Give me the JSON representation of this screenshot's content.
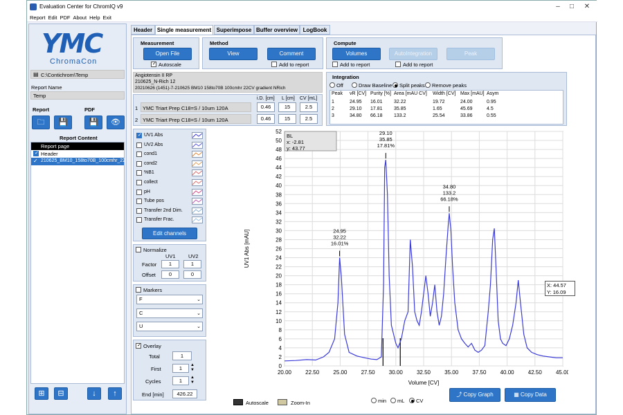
{
  "window": {
    "title": "Evaluation Center for ChromIQ v9"
  },
  "menu": [
    "Report",
    "Edit",
    "PDF",
    "About",
    "Help",
    "Exit"
  ],
  "left": {
    "logo_big": "YMC",
    "logo_small": "ChromaCon",
    "path": "C:\\Contichrom\\Temp",
    "report_name_label": "Report Name",
    "report_name": "Temp",
    "report_label": "Report",
    "pdf_label": "PDF",
    "report_content_label": "Report Content",
    "report_rows": [
      "Report page",
      "Header",
      "210625_BM10_158to70B_100cmhr_22"
    ]
  },
  "tabs": [
    "Header",
    "Single measurement",
    "Superimpose",
    "Buffer overview",
    "LogBook"
  ],
  "measurement": {
    "title": "Measurement",
    "open_file": "Open File",
    "autoscale": "Autoscale"
  },
  "method": {
    "title": "Method",
    "view": "View",
    "comment": "Comment",
    "add_to_report": "Add to report"
  },
  "compute": {
    "title": "Compute",
    "volumes": "Volumes",
    "autointegration": "AutoIntegration",
    "peak": "Peak",
    "add_to_report_1": "Add to report",
    "add_to_report_2": "Add to report"
  },
  "info": {
    "lines": [
      "Angiotensin II RP",
      "210625_N-Rich 12",
      "20210626 (1451)-7-210625 BM10 158to70B 100cmhr 22CV gradient NRich"
    ],
    "col_headers": [
      "i.D. [cm]",
      "L [cm]",
      "CV [mL]"
    ],
    "columns": [
      {
        "idx": "1",
        "name": "YMC Triart Prep C18=S / 10um 120A",
        "id": "0.46",
        "l": "15",
        "cv": "2.5"
      },
      {
        "idx": "2",
        "name": "YMC Triart Prep C18=S / 10um 120A",
        "id": "0.46",
        "l": "15",
        "cv": "2.5"
      }
    ]
  },
  "integration": {
    "title": "Integration",
    "options": [
      "Off",
      "Draw Baseline",
      "Split peaks",
      "Remove peaks"
    ],
    "selected": "Split peaks",
    "headers": [
      "Peak",
      "vR [CV]",
      "Purity [%]",
      "Area [mAU CV]",
      "Width [CV]",
      "Max [mAU]",
      "Asym"
    ],
    "rows": [
      [
        "1",
        "24.95",
        "16.01",
        "32.22",
        "19.72",
        "24.00",
        "0.95"
      ],
      [
        "2",
        "29.10",
        "17.81",
        "35.85",
        "1.65",
        "45.69",
        "4.5"
      ],
      [
        "3",
        "34.80",
        "66.18",
        "133.2",
        "25.54",
        "33.86",
        "0.55"
      ]
    ]
  },
  "channels": {
    "items": [
      {
        "label": "UV1 Abs",
        "checked": true,
        "color": "#3b3bd6"
      },
      {
        "label": "UV2 Abs",
        "checked": false,
        "color": "#5a5ae0"
      },
      {
        "label": "cond1",
        "checked": false,
        "color": "#e08a3c"
      },
      {
        "label": "cond2",
        "checked": false,
        "color": "#e0a05a"
      },
      {
        "label": "%B1",
        "checked": false,
        "color": "#d96b6b"
      },
      {
        "label": "collect",
        "checked": false,
        "color": "#e07070"
      },
      {
        "label": "pH",
        "checked": false,
        "color": "#d64a8a"
      },
      {
        "label": "Tube pos",
        "checked": false,
        "color": "#c05ab0"
      },
      {
        "label": "Transfer 2nd Dim.",
        "checked": false,
        "color": "#8ab0d0"
      },
      {
        "label": "Transfer Frac.",
        "checked": false,
        "color": "#9cc0e0"
      }
    ],
    "edit_button": "Edit channels"
  },
  "normalize": {
    "title": "Normalize",
    "uv1": "UV1",
    "uv2": "UV2",
    "factor_label": "Factor",
    "offset_label": "Offset",
    "factor_uv1": "1",
    "factor_uv2": "1",
    "offset_uv1": "0",
    "offset_uv2": "0"
  },
  "markers": {
    "title": "Markers",
    "selects": [
      "F",
      "C",
      "U"
    ]
  },
  "overlay": {
    "title": "Overlay",
    "total_label": "Total",
    "total": "1",
    "first_label": "First",
    "first": "1",
    "cycles_label": "Cycles",
    "cycles": "1",
    "end_label": "End [min]",
    "end": "426.22"
  },
  "chart_footer": {
    "autoscale": "Autoscale",
    "zoom_in": "Zoom-In",
    "units": [
      "min",
      "mL",
      "CV"
    ],
    "unit_selected": "CV",
    "copy_graph": "Copy Graph",
    "copy_data": "Copy Data"
  },
  "cursor_box": {
    "x": "X: 44.57",
    "y": "Y: 16.09"
  },
  "chart_data": {
    "type": "line",
    "xlabel": "Volume [CV]",
    "ylabel": "UV1 Abs [mAU]",
    "xlim": [
      20.0,
      45.0
    ],
    "ylim": [
      0,
      52
    ],
    "xticks": [
      "20.00",
      "22.50",
      "25.00",
      "27.50",
      "30.00",
      "32.50",
      "35.00",
      "37.50",
      "40.00",
      "42.50",
      "45.00"
    ],
    "yticks": [
      0,
      2,
      4,
      6,
      8,
      10,
      12,
      14,
      16,
      18,
      20,
      22,
      24,
      26,
      28,
      30,
      32,
      34,
      36,
      38,
      40,
      42,
      44,
      46,
      48,
      50,
      52
    ],
    "grid": true,
    "legend_box": {
      "label": "BL",
      "x": "x: -2.81",
      "y": "y: 43.77"
    },
    "series": [
      {
        "color": "#3a3ad9",
        "x": [
          20.0,
          21.0,
          22.0,
          22.8,
          23.5,
          24.0,
          24.5,
          24.8,
          24.95,
          25.1,
          25.4,
          25.8,
          26.5,
          27.2,
          27.8,
          28.3,
          28.7,
          28.9,
          29.0,
          29.1,
          29.25,
          29.4,
          29.6,
          29.8,
          30.0,
          30.2,
          30.5,
          30.8,
          31.1,
          31.3,
          31.5,
          31.7,
          31.9,
          32.1,
          32.3,
          32.5,
          32.7,
          32.9,
          33.1,
          33.3,
          33.5,
          33.7,
          33.9,
          34.1,
          34.3,
          34.5,
          34.7,
          34.8,
          34.95,
          35.1,
          35.3,
          35.6,
          35.9,
          36.2,
          36.5,
          36.8,
          37.1,
          37.4,
          37.7,
          38.0,
          38.3,
          38.5,
          38.7,
          38.85,
          39.0,
          39.2,
          39.4,
          39.6,
          39.9,
          40.2,
          40.5,
          40.8,
          41.0,
          41.2,
          41.5,
          41.8,
          42.2,
          42.7,
          43.2,
          43.8,
          44.4,
          45.0
        ],
        "y": [
          1.1,
          1.2,
          1.4,
          1.3,
          2.0,
          3.0,
          6.0,
          14.0,
          24.0,
          20.0,
          7.0,
          3.0,
          2.2,
          1.8,
          1.5,
          1.4,
          2.0,
          18.0,
          44.0,
          45.69,
          38.0,
          20.0,
          9.0,
          7.0,
          5.0,
          4.0,
          6.0,
          10.0,
          12.0,
          28.0,
          22.0,
          12.0,
          10.0,
          9.0,
          12.0,
          16.0,
          20.0,
          16.0,
          11.0,
          14.0,
          18.0,
          12.0,
          9.0,
          11.0,
          16.0,
          24.0,
          31.0,
          33.86,
          30.0,
          22.0,
          14.0,
          8.0,
          6.0,
          5.0,
          4.2,
          5.0,
          3.5,
          3.0,
          3.5,
          4.5,
          12.0,
          18.0,
          28.0,
          30.5,
          22.0,
          10.0,
          6.0,
          5.0,
          4.5,
          6.0,
          9.0,
          14.0,
          19.0,
          14.0,
          7.0,
          4.0,
          3.0,
          2.5,
          2.2,
          2.0,
          1.8,
          1.8
        ]
      }
    ],
    "annotations": [
      {
        "x": 24.95,
        "y": 24.0,
        "lines": [
          "24.95",
          "32.22",
          "16.01%"
        ]
      },
      {
        "x": 29.1,
        "y": 45.69,
        "lines": [
          "29.10",
          "35.85",
          "17.81%"
        ]
      },
      {
        "x": 34.8,
        "y": 33.86,
        "lines": [
          "34.80",
          "133.2",
          "66.18%"
        ]
      }
    ],
    "markers_v": [
      28.85,
      30.4
    ]
  }
}
